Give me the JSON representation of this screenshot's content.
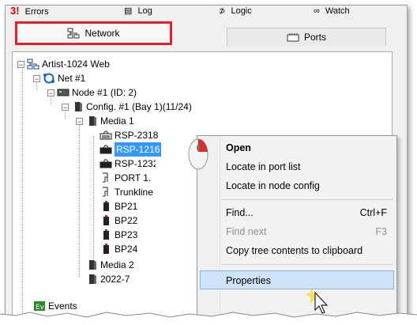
{
  "top_tabs": {
    "errors_label": "Errors",
    "log_label": "Log",
    "logic_label": "Logic",
    "watch_label": "Watch"
  },
  "tabs": {
    "network_label": "Network",
    "ports_label": "Ports"
  },
  "tree": {
    "root": "Artist-1024 Web",
    "net": "Net #1",
    "node": "Node #1 (ID: 2)",
    "config": "Config. #1 (Bay  1)(11/24)",
    "media1": "Media 1",
    "items": [
      "RSP-2318",
      "RSP-1216",
      "RSP-1232",
      "PORT 1.",
      "Trunkline",
      "BP21",
      "BP22",
      "BP23",
      "BP24"
    ],
    "media2": "Media 2",
    "year": "2022-7",
    "events": "Events"
  },
  "context_menu": {
    "open": "Open",
    "locate_port": "Locate in port list",
    "locate_node": "Locate in node config",
    "find": "Find...",
    "find_shortcut": "Ctrl+F",
    "find_next": "Find next",
    "find_next_shortcut": "F3",
    "copy_tree": "Copy tree contents to clipboard",
    "properties": "Properties"
  },
  "colors": {
    "highlight_border": "#e0202a",
    "selection": "#3399ff",
    "menu_hover": "#cde3f7"
  }
}
